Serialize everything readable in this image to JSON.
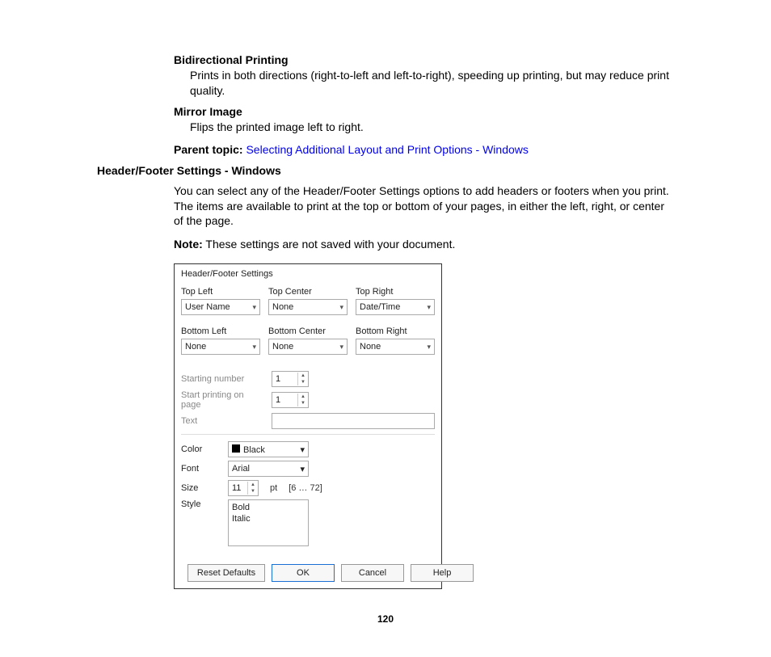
{
  "defs": {
    "bidir": {
      "term": "Bidirectional Printing",
      "desc": "Prints in both directions (right-to-left and left-to-right), speeding up printing, but may reduce print quality."
    },
    "mirror": {
      "term": "Mirror Image",
      "desc": "Flips the printed image left to right."
    }
  },
  "parent_topic": {
    "label": "Parent topic:",
    "link": "Selecting Additional Layout and Print Options - Windows"
  },
  "section_title": "Header/Footer Settings - Windows",
  "intro": "You can select any of the Header/Footer Settings options to add headers or footers when you print. The items are available to print at the top or bottom of your pages, in either the left, right, or center of the page.",
  "note_label": "Note:",
  "note_text": " These settings are not saved with your document.",
  "dialog": {
    "title": "Header/Footer Settings",
    "top_left": {
      "label": "Top Left",
      "value": "User Name"
    },
    "top_center": {
      "label": "Top Center",
      "value": "None"
    },
    "top_right": {
      "label": "Top Right",
      "value": "Date/Time"
    },
    "bottom_left": {
      "label": "Bottom Left",
      "value": "None"
    },
    "bottom_center": {
      "label": "Bottom Center",
      "value": "None"
    },
    "bottom_right": {
      "label": "Bottom Right",
      "value": "None"
    },
    "starting_number": {
      "label": "Starting number",
      "value": "1"
    },
    "start_on_page": {
      "label": "Start printing on page",
      "value": "1"
    },
    "text_label": "Text",
    "color": {
      "label": "Color",
      "value": "Black"
    },
    "font": {
      "label": "Font",
      "value": "Arial"
    },
    "size": {
      "label": "Size",
      "value": "11",
      "unit": "pt",
      "range": "[6 … 72]"
    },
    "style": {
      "label": "Style",
      "options": [
        "Bold",
        "Italic"
      ]
    },
    "buttons": {
      "reset": "Reset Defaults",
      "ok": "OK",
      "cancel": "Cancel",
      "help": "Help"
    }
  },
  "page_number": "120"
}
